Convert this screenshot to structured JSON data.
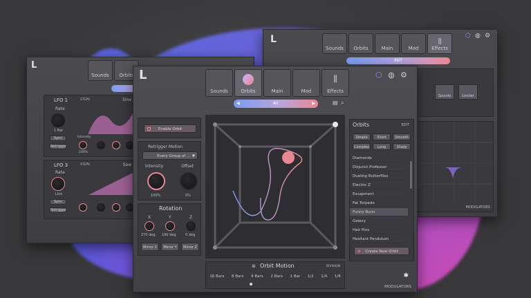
{
  "logo": "L",
  "tabs": [
    "Sounds",
    "Orbits",
    "Main",
    "Mod",
    "Effects"
  ],
  "pill": {
    "center": "Air",
    "right_window": "INIT"
  },
  "lfo1": {
    "title": "LFO 1",
    "steps": "STEPS",
    "wave": "Sine",
    "rate": "Rate",
    "rate_val": "1 Bar",
    "sync": "Sync",
    "retrigger": "Retrigger",
    "knobs": [
      "Intensity",
      "Fade In",
      "Smoothing",
      "Delay"
    ],
    "vals": [
      "100%",
      "0 ms",
      "90 ms",
      "0 ms"
    ]
  },
  "lfo3": {
    "title": "LFO 3",
    "steps": "STEPS",
    "wave": "Saw",
    "rate": "Rate",
    "rate_val": "Link",
    "sync": "Sync",
    "retrigger": "Retrigger",
    "knobs": [
      "Intensity",
      "Fade In",
      "Smoothing",
      "Delay"
    ],
    "vals": [
      "100%",
      "0 ms",
      "90 ms",
      "0 ms"
    ]
  },
  "orbit_left": {
    "enable": "Enable Orbit",
    "retrigger_motion": "Retrigger Motion",
    "every_group": "Every Group of ...",
    "intensity": "Intensity",
    "intensity_val": "100%",
    "offset": "Offset",
    "offset_val": "0%",
    "rotation": "Rotation",
    "axes": [
      "X",
      "Y",
      "Z"
    ],
    "axis_vals": [
      "270 deg",
      "180 deg",
      "0 deg"
    ],
    "mirrors": [
      "Mirror X",
      "Mirror Y",
      "Mirror Z"
    ]
  },
  "orbit_motion": {
    "title": "Orbit Motion",
    "division": "DIVISION",
    "bars": [
      "16 Bars",
      "8 Bars",
      "4 Bars",
      "2 Bars",
      "1 Bar",
      "1/2",
      "1/4",
      "1/8"
    ]
  },
  "orbits_panel": {
    "title": "Orbits",
    "edit": "EDIT",
    "filters": [
      "Simple",
      "Short",
      "Smooth",
      "Complex",
      "Long",
      "Sharp"
    ],
    "items": [
      "Diamonds",
      "Disjunct Professor",
      "Dueling Butterflies",
      "Electric Z",
      "Escapment",
      "Fat Torpedo",
      "Funny Bunn",
      "Galaxy",
      "Hair Pins",
      "Hesitant Pendulum"
    ],
    "create": "Create New Orbit"
  },
  "right_panel": {
    "buttons": [
      "Sounds",
      "Limiter"
    ]
  },
  "modulators": "MODULATORS",
  "colors": {
    "accent_pink": "#e98892",
    "accent_blue": "#7a9cf0",
    "accent_purple": "#8b6fe0",
    "blob_blue": "#4a63d8",
    "blob_pink": "#c04bb8"
  }
}
